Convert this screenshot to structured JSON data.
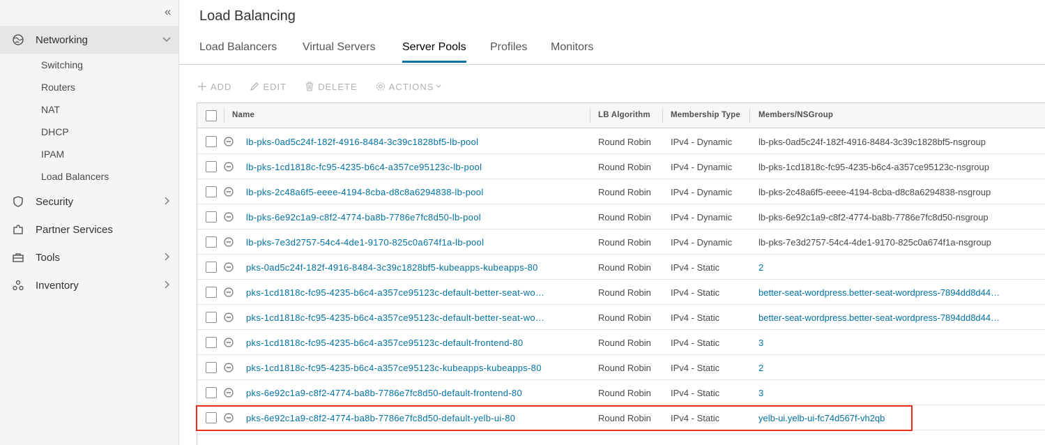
{
  "sidebar": {
    "collapse_glyph": "«",
    "groups": [
      {
        "label": "Networking",
        "icon": "globe-icon"
      },
      {
        "label": "Security",
        "icon": "shield-icon"
      },
      {
        "label": "Partner Services",
        "icon": "puzzle-icon"
      },
      {
        "label": "Tools",
        "icon": "toolbox-icon"
      },
      {
        "label": "Inventory",
        "icon": "inventory-icon"
      }
    ],
    "networking_items": [
      "Switching",
      "Routers",
      "NAT",
      "DHCP",
      "IPAM",
      "Load Balancers"
    ]
  },
  "main": {
    "title": "Load Balancing",
    "tabs": [
      "Load Balancers",
      "Virtual Servers",
      "Server Pools",
      "Profiles",
      "Monitors"
    ],
    "active_tab": "Server Pools",
    "toolbar": {
      "add": "ADD",
      "edit": "EDIT",
      "delete": "DELETE",
      "actions": "ACTIONS"
    },
    "columns": [
      "Name",
      "LB Algorithm",
      "Membership Type",
      "Members/NSGroup"
    ],
    "rows": [
      {
        "name": "lb-pks-0ad5c24f-182f-4916-8484-3c39c1828bf5-lb-pool",
        "algo": "Round Robin",
        "type": "IPv4 - Dynamic",
        "members": "lb-pks-0ad5c24f-182f-4916-8484-3c39c1828bf5-nsgroup"
      },
      {
        "name": "lb-pks-1cd1818c-fc95-4235-b6c4-a357ce95123c-lb-pool",
        "algo": "Round Robin",
        "type": "IPv4 - Dynamic",
        "members": "lb-pks-1cd1818c-fc95-4235-b6c4-a357ce95123c-nsgroup"
      },
      {
        "name": "lb-pks-2c48a6f5-eeee-4194-8cba-d8c8a6294838-lb-pool",
        "algo": "Round Robin",
        "type": "IPv4 - Dynamic",
        "members": "lb-pks-2c48a6f5-eeee-4194-8cba-d8c8a6294838-nsgroup"
      },
      {
        "name": "lb-pks-6e92c1a9-c8f2-4774-ba8b-7786e7fc8d50-lb-pool",
        "algo": "Round Robin",
        "type": "IPv4 - Dynamic",
        "members": "lb-pks-6e92c1a9-c8f2-4774-ba8b-7786e7fc8d50-nsgroup"
      },
      {
        "name": "lb-pks-7e3d2757-54c4-4de1-9170-825c0a674f1a-lb-pool",
        "algo": "Round Robin",
        "type": "IPv4 - Dynamic",
        "members": "lb-pks-7e3d2757-54c4-4de1-9170-825c0a674f1a-nsgroup"
      },
      {
        "name": "pks-0ad5c24f-182f-4916-8484-3c39c1828bf5-kubeapps-kubeapps-80",
        "algo": "Round Robin",
        "type": "IPv4 - Static",
        "members": "2"
      },
      {
        "name": "pks-1cd1818c-fc95-4235-b6c4-a357ce95123c-default-better-seat-wo…",
        "algo": "Round Robin",
        "type": "IPv4 - Static",
        "members": "better-seat-wordpress.better-seat-wordpress-7894dd8d44…"
      },
      {
        "name": "pks-1cd1818c-fc95-4235-b6c4-a357ce95123c-default-better-seat-wo…",
        "algo": "Round Robin",
        "type": "IPv4 - Static",
        "members": "better-seat-wordpress.better-seat-wordpress-7894dd8d44…"
      },
      {
        "name": "pks-1cd1818c-fc95-4235-b6c4-a357ce95123c-default-frontend-80",
        "algo": "Round Robin",
        "type": "IPv4 - Static",
        "members": "3"
      },
      {
        "name": "pks-1cd1818c-fc95-4235-b6c4-a357ce95123c-kubeapps-kubeapps-80",
        "algo": "Round Robin",
        "type": "IPv4 - Static",
        "members": "2"
      },
      {
        "name": "pks-6e92c1a9-c8f2-4774-ba8b-7786e7fc8d50-default-frontend-80",
        "algo": "Round Robin",
        "type": "IPv4 - Static",
        "members": "3"
      },
      {
        "name": "pks-6e92c1a9-c8f2-4774-ba8b-7786e7fc8d50-default-yelb-ui-80",
        "algo": "Round Robin",
        "type": "IPv4 - Static",
        "members": "yelb-ui.yelb-ui-fc74d567f-vh2qb"
      }
    ]
  },
  "colors": {
    "link": "#0072a3",
    "highlight": "#e8311f",
    "sidebar_bg": "#f5f5f5"
  }
}
